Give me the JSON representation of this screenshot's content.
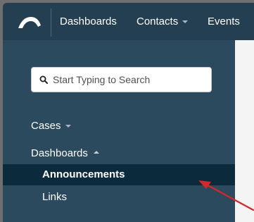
{
  "topbar": {
    "nav": [
      {
        "label": "Dashboards"
      },
      {
        "label": "Contacts"
      },
      {
        "label": "Events"
      }
    ]
  },
  "sidebar": {
    "search": {
      "placeholder": "Start Typing to Search"
    },
    "sections": [
      {
        "label": "Cases"
      },
      {
        "label": "Dashboards"
      }
    ],
    "dashboard_items": [
      {
        "label": "Announcements",
        "active": true
      },
      {
        "label": "Links",
        "active": false
      }
    ]
  },
  "colors": {
    "topbar": "#243f52",
    "sidebar": "#2c4a5e",
    "active_item": "#0b2a3c",
    "annotation_arrow": "#d8262b"
  },
  "icons": {
    "logo": "cloud-arc-logo",
    "search": "search-icon",
    "annotation": "red-arrow"
  }
}
